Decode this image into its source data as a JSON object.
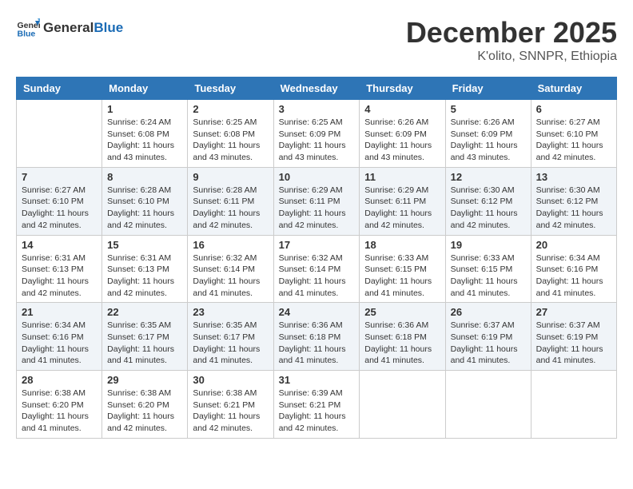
{
  "header": {
    "logo_general": "General",
    "logo_blue": "Blue",
    "month": "December 2025",
    "location": "K'olito, SNNPR, Ethiopia"
  },
  "weekdays": [
    "Sunday",
    "Monday",
    "Tuesday",
    "Wednesday",
    "Thursday",
    "Friday",
    "Saturday"
  ],
  "weeks": [
    [
      {
        "day": "",
        "info": ""
      },
      {
        "day": "1",
        "info": "Sunrise: 6:24 AM\nSunset: 6:08 PM\nDaylight: 11 hours\nand 43 minutes."
      },
      {
        "day": "2",
        "info": "Sunrise: 6:25 AM\nSunset: 6:08 PM\nDaylight: 11 hours\nand 43 minutes."
      },
      {
        "day": "3",
        "info": "Sunrise: 6:25 AM\nSunset: 6:09 PM\nDaylight: 11 hours\nand 43 minutes."
      },
      {
        "day": "4",
        "info": "Sunrise: 6:26 AM\nSunset: 6:09 PM\nDaylight: 11 hours\nand 43 minutes."
      },
      {
        "day": "5",
        "info": "Sunrise: 6:26 AM\nSunset: 6:09 PM\nDaylight: 11 hours\nand 43 minutes."
      },
      {
        "day": "6",
        "info": "Sunrise: 6:27 AM\nSunset: 6:10 PM\nDaylight: 11 hours\nand 42 minutes."
      }
    ],
    [
      {
        "day": "7",
        "info": "Sunrise: 6:27 AM\nSunset: 6:10 PM\nDaylight: 11 hours\nand 42 minutes."
      },
      {
        "day": "8",
        "info": "Sunrise: 6:28 AM\nSunset: 6:10 PM\nDaylight: 11 hours\nand 42 minutes."
      },
      {
        "day": "9",
        "info": "Sunrise: 6:28 AM\nSunset: 6:11 PM\nDaylight: 11 hours\nand 42 minutes."
      },
      {
        "day": "10",
        "info": "Sunrise: 6:29 AM\nSunset: 6:11 PM\nDaylight: 11 hours\nand 42 minutes."
      },
      {
        "day": "11",
        "info": "Sunrise: 6:29 AM\nSunset: 6:11 PM\nDaylight: 11 hours\nand 42 minutes."
      },
      {
        "day": "12",
        "info": "Sunrise: 6:30 AM\nSunset: 6:12 PM\nDaylight: 11 hours\nand 42 minutes."
      },
      {
        "day": "13",
        "info": "Sunrise: 6:30 AM\nSunset: 6:12 PM\nDaylight: 11 hours\nand 42 minutes."
      }
    ],
    [
      {
        "day": "14",
        "info": "Sunrise: 6:31 AM\nSunset: 6:13 PM\nDaylight: 11 hours\nand 42 minutes."
      },
      {
        "day": "15",
        "info": "Sunrise: 6:31 AM\nSunset: 6:13 PM\nDaylight: 11 hours\nand 42 minutes."
      },
      {
        "day": "16",
        "info": "Sunrise: 6:32 AM\nSunset: 6:14 PM\nDaylight: 11 hours\nand 41 minutes."
      },
      {
        "day": "17",
        "info": "Sunrise: 6:32 AM\nSunset: 6:14 PM\nDaylight: 11 hours\nand 41 minutes."
      },
      {
        "day": "18",
        "info": "Sunrise: 6:33 AM\nSunset: 6:15 PM\nDaylight: 11 hours\nand 41 minutes."
      },
      {
        "day": "19",
        "info": "Sunrise: 6:33 AM\nSunset: 6:15 PM\nDaylight: 11 hours\nand 41 minutes."
      },
      {
        "day": "20",
        "info": "Sunrise: 6:34 AM\nSunset: 6:16 PM\nDaylight: 11 hours\nand 41 minutes."
      }
    ],
    [
      {
        "day": "21",
        "info": "Sunrise: 6:34 AM\nSunset: 6:16 PM\nDaylight: 11 hours\nand 41 minutes."
      },
      {
        "day": "22",
        "info": "Sunrise: 6:35 AM\nSunset: 6:17 PM\nDaylight: 11 hours\nand 41 minutes."
      },
      {
        "day": "23",
        "info": "Sunrise: 6:35 AM\nSunset: 6:17 PM\nDaylight: 11 hours\nand 41 minutes."
      },
      {
        "day": "24",
        "info": "Sunrise: 6:36 AM\nSunset: 6:18 PM\nDaylight: 11 hours\nand 41 minutes."
      },
      {
        "day": "25",
        "info": "Sunrise: 6:36 AM\nSunset: 6:18 PM\nDaylight: 11 hours\nand 41 minutes."
      },
      {
        "day": "26",
        "info": "Sunrise: 6:37 AM\nSunset: 6:19 PM\nDaylight: 11 hours\nand 41 minutes."
      },
      {
        "day": "27",
        "info": "Sunrise: 6:37 AM\nSunset: 6:19 PM\nDaylight: 11 hours\nand 41 minutes."
      }
    ],
    [
      {
        "day": "28",
        "info": "Sunrise: 6:38 AM\nSunset: 6:20 PM\nDaylight: 11 hours\nand 41 minutes."
      },
      {
        "day": "29",
        "info": "Sunrise: 6:38 AM\nSunset: 6:20 PM\nDaylight: 11 hours\nand 42 minutes."
      },
      {
        "day": "30",
        "info": "Sunrise: 6:38 AM\nSunset: 6:21 PM\nDaylight: 11 hours\nand 42 minutes."
      },
      {
        "day": "31",
        "info": "Sunrise: 6:39 AM\nSunset: 6:21 PM\nDaylight: 11 hours\nand 42 minutes."
      },
      {
        "day": "",
        "info": ""
      },
      {
        "day": "",
        "info": ""
      },
      {
        "day": "",
        "info": ""
      }
    ]
  ]
}
